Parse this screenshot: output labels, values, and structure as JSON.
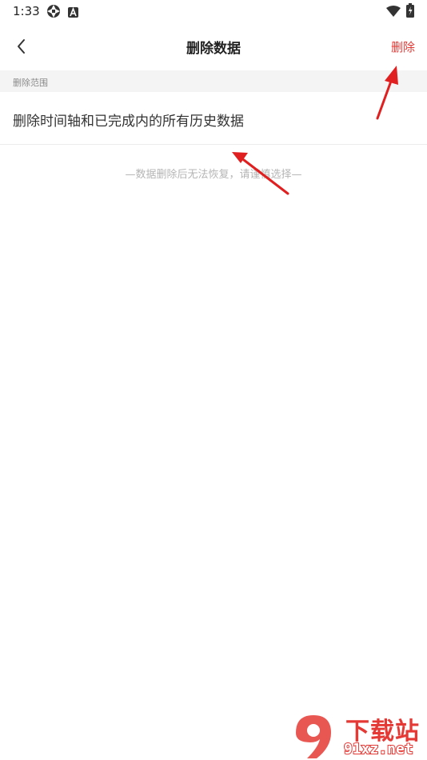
{
  "status_bar": {
    "time": "1:33",
    "left_icons": [
      "aperture-icon",
      "notification-a-icon"
    ],
    "right_icons": [
      "wifi-icon",
      "battery-icon"
    ]
  },
  "header": {
    "back_icon": "chevron-left-icon",
    "title": "删除数据",
    "action_label": "删除",
    "action_color": "#e53935"
  },
  "section": {
    "label": "删除范围",
    "option_text": "删除时间轴和已完成内的所有历史数据"
  },
  "hint": "—数据删除后无法恢复，请谨慎选择—",
  "annotations": {
    "arrow_color": "#e02020"
  },
  "watermark": {
    "top_text": "下载站",
    "bottom_text": "91xz.net",
    "color": "#e53935"
  }
}
